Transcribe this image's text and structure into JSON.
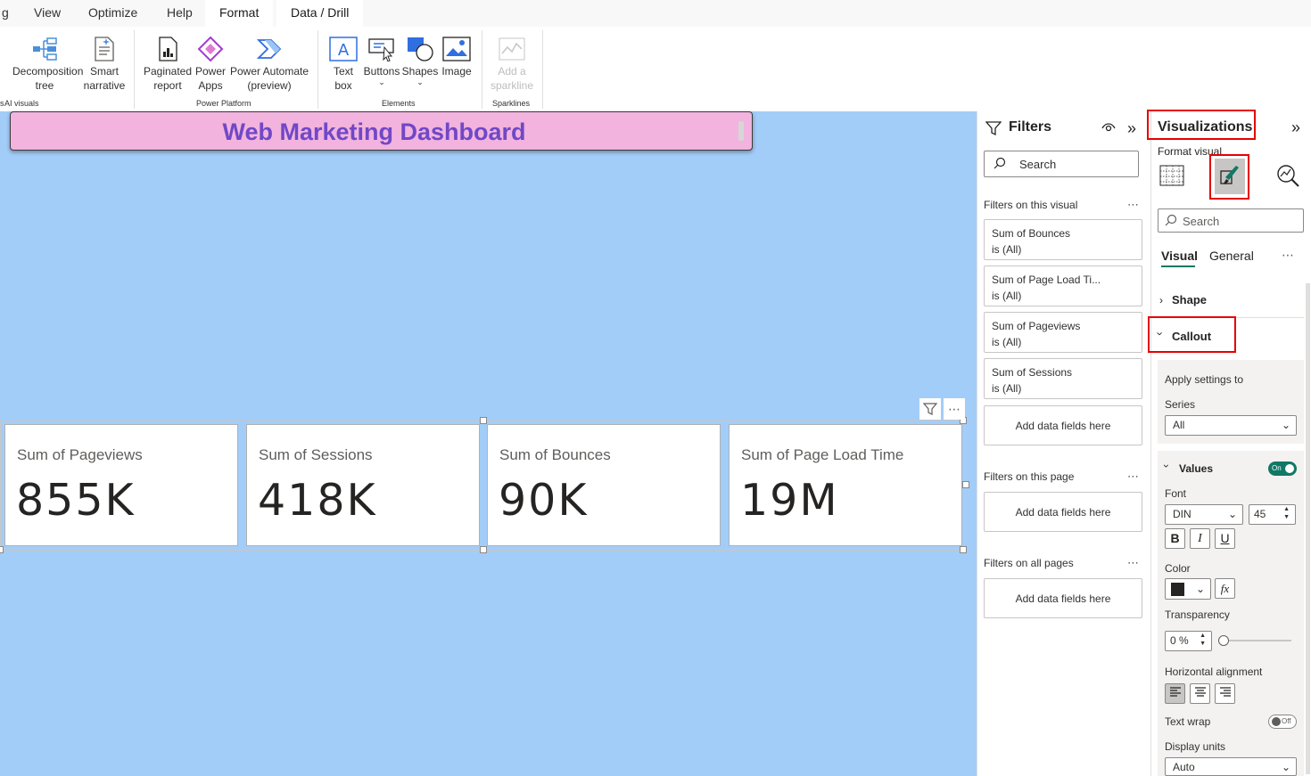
{
  "ribbon": {
    "tabs": [
      "g",
      "View",
      "Optimize",
      "Help",
      "Format",
      "Data / Drill"
    ],
    "buttons": {
      "decomposition": "Decomposition tree",
      "smart_narrative": "Smart narrative",
      "paginated": "Paginated report",
      "power_apps": "Power Apps",
      "power_automate": "Power Automate (preview)",
      "text_box": "Text box",
      "buttons": "Buttons",
      "shapes": "Shapes",
      "image": "Image",
      "sparkline": "Add a sparkline"
    },
    "groups": {
      "ai": "AI visuals",
      "ai_prefix": "s",
      "power_platform": "Power Platform",
      "elements": "Elements",
      "sparklines": "Sparklines"
    }
  },
  "canvas": {
    "title": "Web Marketing Dashboard",
    "cards": [
      {
        "label": "Sum of Pageviews",
        "value": "855K"
      },
      {
        "label": "Sum of Sessions",
        "value": "418K"
      },
      {
        "label": "Sum of Bounces",
        "value": "90K"
      },
      {
        "label": "Sum of Page Load Time",
        "value": "19M"
      }
    ]
  },
  "filters": {
    "title": "Filters",
    "search_placeholder": "Search",
    "on_visual": "Filters on this visual",
    "visual_filters": [
      {
        "name": "Sum of Bounces",
        "state": "is (All)"
      },
      {
        "name": "Sum of Page Load Ti...",
        "state": "is (All)"
      },
      {
        "name": "Sum of Pageviews",
        "state": "is (All)"
      },
      {
        "name": "Sum of Sessions",
        "state": "is (All)"
      }
    ],
    "add_fields": "Add data fields here",
    "on_page": "Filters on this page",
    "on_all_pages": "Filters on all pages"
  },
  "viz": {
    "title": "Visualizations",
    "format_visual": "Format visual",
    "search_placeholder": "Search",
    "tab_visual": "Visual",
    "tab_general": "General",
    "shape": "Shape",
    "callout": "Callout",
    "apply_settings": "Apply settings to",
    "series_label": "Series",
    "series_value": "All",
    "values": "Values",
    "values_toggle": "On",
    "font_label": "Font",
    "font_value": "DIN",
    "font_size": "45",
    "bold": "B",
    "italic": "I",
    "underline": "U",
    "color_label": "Color",
    "color_value": "#252423",
    "fx": "fx",
    "transparency_label": "Transparency",
    "transparency_value": "0 %",
    "halign_label": "Horizontal alignment",
    "text_wrap_label": "Text wrap",
    "text_wrap_toggle": "Off",
    "display_units_label": "Display units",
    "display_units_value": "Auto"
  }
}
